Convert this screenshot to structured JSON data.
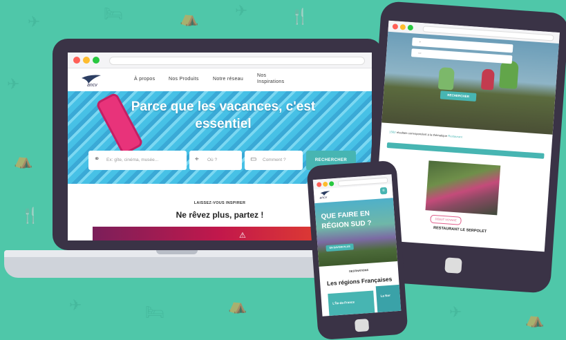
{
  "colors": {
    "background": "#4fc7a9",
    "accent": "#47b5b2",
    "device": "#3a3346"
  },
  "laptop": {
    "logo_text": "ancv",
    "nav": [
      "À propos",
      "Nos Produits",
      "Notre réseau",
      "Nos Inspirations"
    ],
    "hero_title": "Parce que les vacances, c'est essentiel",
    "search": {
      "what_placeholder": "Ex: gîte, cinéma, musée...",
      "where_placeholder": "Où ?",
      "how_placeholder": "Comment ?",
      "button_label": "RECHERCHER"
    },
    "inspire_kicker": "LAISSEZ-VOUS INSPIRER",
    "inspire_title": "Ne rêvez plus, partez !"
  },
  "tablet": {
    "search_button": "RECHERCHER",
    "results_prefix": "1562",
    "results_text": " résultats correspondent à la thématique",
    "results_highlight": " Restaurant",
    "card_badge": "DEBUT VOYAGE",
    "card_title": "RESTAURANT LE SERPOLET"
  },
  "phone": {
    "logo_text": "ancv",
    "hero_title": "QUE FAIRE EN RÉGION SUD ?",
    "hero_button": "EN SAVOIR PLUS",
    "kicker": "DESTINATIONS",
    "section_title": "Les régions Françaises",
    "region1": "L'Île-de-France",
    "region2": "La Nor"
  }
}
